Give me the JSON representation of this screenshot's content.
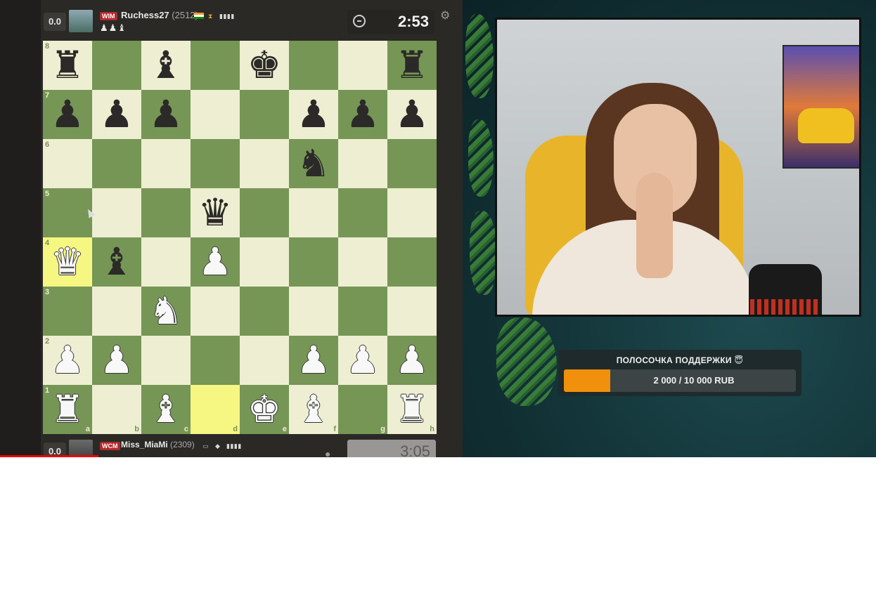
{
  "top_player": {
    "score": "0.0",
    "title": "WIM",
    "name": "Ruchess27",
    "rating": "(2512)",
    "signal": "▮▮▮▮",
    "captured": "♟♟♝",
    "clock": "2:53"
  },
  "bottom_player": {
    "score": "0.0",
    "title": "WCM",
    "name": "Miss_MiaMi",
    "rating": "(2309)",
    "signal": "▮▮▮▮",
    "clock": "3:05"
  },
  "board": {
    "files": [
      "a",
      "b",
      "c",
      "d",
      "e",
      "f",
      "g",
      "h"
    ],
    "ranks": [
      "8",
      "7",
      "6",
      "5",
      "4",
      "3",
      "2",
      "1"
    ],
    "rows": [
      [
        "r",
        "",
        "b",
        "",
        "k",
        "",
        "",
        "r"
      ],
      [
        "p",
        "p",
        "p",
        "",
        "",
        "p",
        "p",
        "p"
      ],
      [
        "",
        "",
        "",
        "",
        "",
        "n",
        "",
        ""
      ],
      [
        "",
        "",
        "",
        "q",
        "",
        "",
        "",
        ""
      ],
      [
        "Q",
        "b",
        "",
        "P",
        "",
        "",
        "",
        ""
      ],
      [
        "",
        "",
        "N",
        "",
        "",
        "",
        "",
        ""
      ],
      [
        "P",
        "P",
        "",
        "",
        "",
        "P",
        "P",
        "P"
      ],
      [
        "R",
        "",
        "B",
        "",
        "K",
        "B",
        "",
        "R"
      ]
    ],
    "highlighted": [
      "a4",
      "d1"
    ],
    "colors": {
      "light": "#eeeed2",
      "dark": "#769656"
    }
  },
  "donation": {
    "title": "ПОЛОСОЧКА ПОДДЕРЖКИ 😇",
    "progress_text": "2 000 / 10 000 RUB",
    "progress_fraction": 0.2,
    "fill_color": "#f0900c"
  }
}
